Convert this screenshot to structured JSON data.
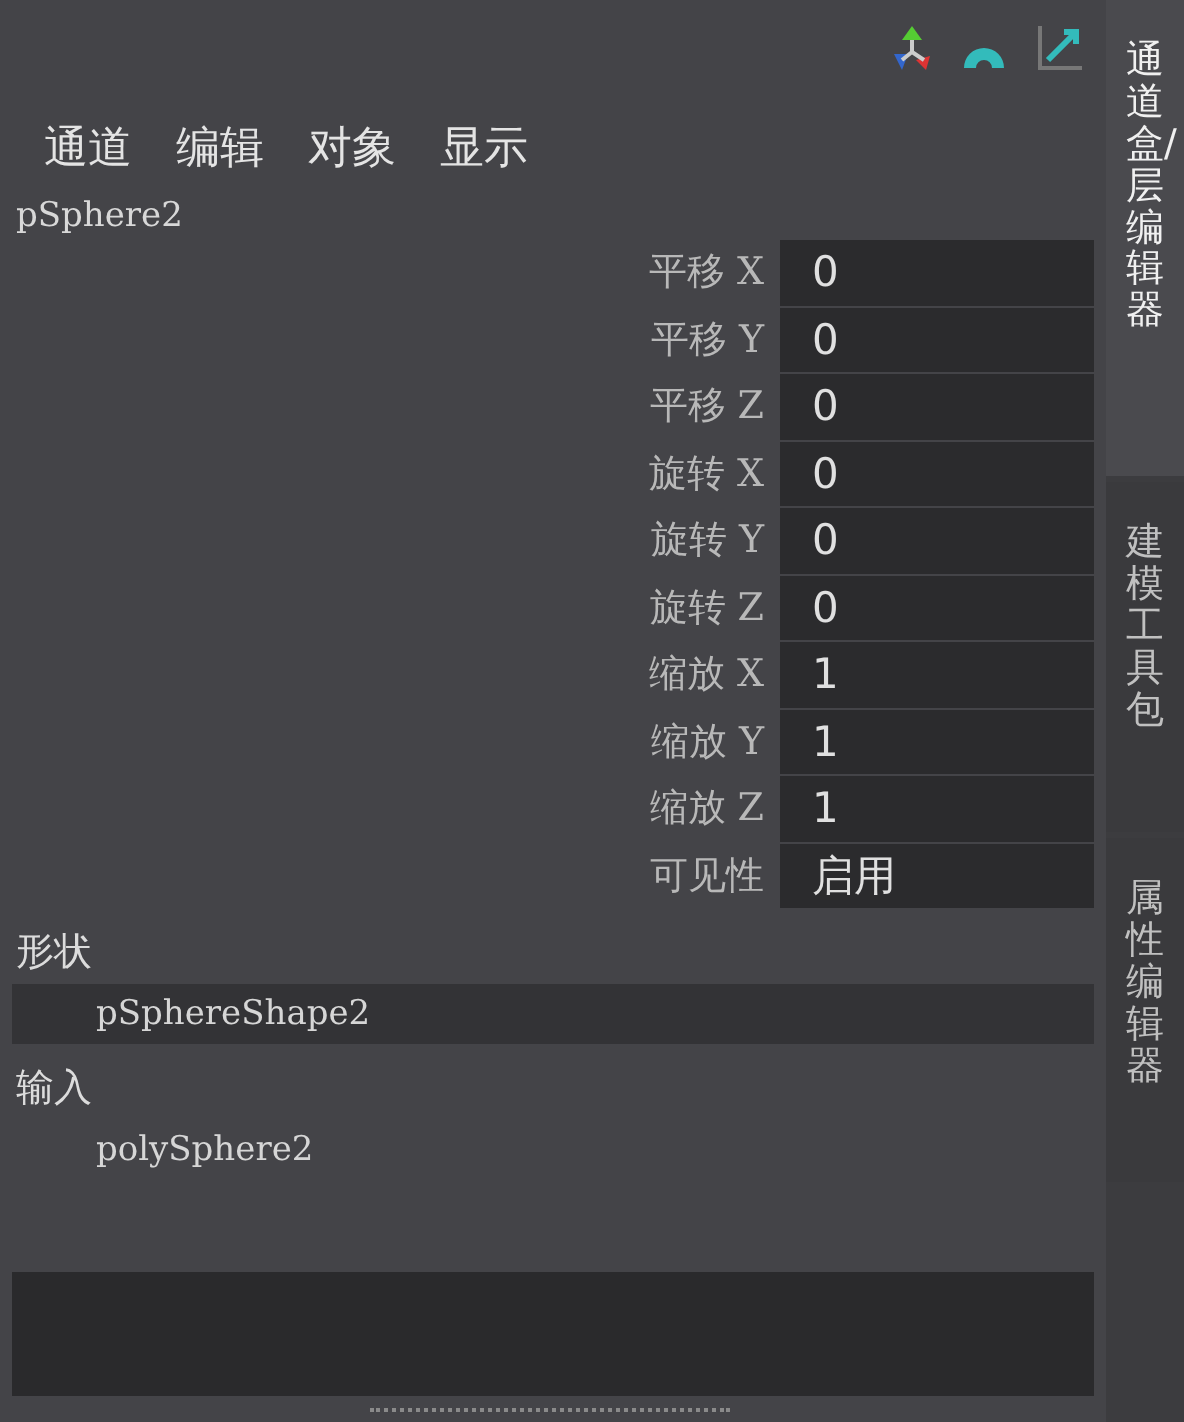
{
  "menu": [
    "通道",
    "编辑",
    "对象",
    "显示"
  ],
  "object_name": "pSphere2",
  "attributes": [
    {
      "label": "平移 X",
      "value": "0"
    },
    {
      "label": "平移 Y",
      "value": "0"
    },
    {
      "label": "平移 Z",
      "value": "0"
    },
    {
      "label": "旋转 X",
      "value": "0"
    },
    {
      "label": "旋转 Y",
      "value": "0"
    },
    {
      "label": "旋转 Z",
      "value": "0"
    },
    {
      "label": "缩放 X",
      "value": "1"
    },
    {
      "label": "缩放 Y",
      "value": "1"
    },
    {
      "label": "缩放 Z",
      "value": "1"
    },
    {
      "label": "可见性",
      "value": "启用"
    }
  ],
  "sections": [
    {
      "title": "形状",
      "items": [
        {
          "name": "pSphereShape2",
          "selected": true
        }
      ]
    },
    {
      "title": "输入",
      "items": [
        {
          "name": "polySphere2",
          "selected": false
        }
      ]
    }
  ],
  "side_tabs": [
    {
      "label": "通道盒/层编辑器",
      "selected": true
    },
    {
      "label": "建模工具包",
      "selected": false
    },
    {
      "label": "属性编辑器",
      "selected": false
    }
  ]
}
